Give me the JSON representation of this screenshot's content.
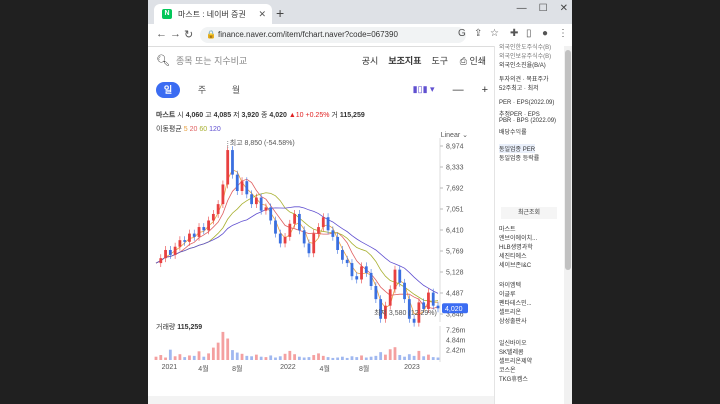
{
  "browser": {
    "tab_title": "마스트 : 네이버 증권",
    "tab_fav": "N",
    "url": "finance.naver.com/item/fchart.naver?code=067390"
  },
  "toolbar": {
    "search_placeholder": "종목 또는 지수비교",
    "links": [
      "공시",
      "보조지표",
      "도구"
    ],
    "print": "인쇄"
  },
  "periods": [
    "일",
    "주",
    "월"
  ],
  "quote": {
    "name": "마스트",
    "open_label": "시",
    "open": "4,060",
    "high_label": "고",
    "high": "4,085",
    "low_label": "저",
    "low": "3,920",
    "close_label": "종",
    "close": "4,020",
    "change": "▲10 +0.25%",
    "vol_label": "거",
    "vol": "115,259"
  },
  "ma": {
    "label": "이동평균",
    "p5": "5",
    "p20": "20",
    "p60": "60",
    "p120": "120"
  },
  "scale_mode": "Linear",
  "chart_data": {
    "type": "line",
    "y_ticks": [
      "8,974",
      "8,333",
      "7,692",
      "7,051",
      "6,410",
      "5,769",
      "5,128",
      "4,487",
      "3,846"
    ],
    "current": "4,020",
    "high_annotation": "최고 8,850 (-54.58%)",
    "low_annotation": "최저 3,580 (12.29%)",
    "price": [
      5400,
      5550,
      5800,
      5650,
      5900,
      6100,
      6050,
      6300,
      6200,
      6500,
      6400,
      6700,
      6900,
      7200,
      7800,
      8850,
      8100,
      7600,
      7900,
      7500,
      7200,
      7400,
      7000,
      7100,
      6700,
      6300,
      6000,
      6200,
      6600,
      6900,
      6400,
      6000,
      5700,
      6300,
      6500,
      6800,
      6400,
      6200,
      5800,
      5500,
      5400,
      5000,
      4900,
      5300,
      5100,
      4700,
      4300,
      3700,
      4100,
      4600,
      5200,
      4800,
      4300,
      3700,
      3580,
      4200,
      4000,
      4500,
      4100,
      4020
    ],
    "ma_colors": [
      "#e8a040",
      "#e06060",
      "#a8b030",
      "#6050d0"
    ],
    "volume_label": "거래량",
    "volume_value": "115,259",
    "volume_ticks": [
      "7.26m",
      "4.84m",
      "2.42m"
    ],
    "volume": [
      0.8,
      1.2,
      0.6,
      2.5,
      0.9,
      1.4,
      0.7,
      1.1,
      1.0,
      2.1,
      0.8,
      1.6,
      3.0,
      4.2,
      6.8,
      5.2,
      2.4,
      1.8,
      1.5,
      1.0,
      0.9,
      1.3,
      0.8,
      0.7,
      1.1,
      0.6,
      0.9,
      1.5,
      2.2,
      1.4,
      0.8,
      0.6,
      0.7,
      1.2,
      1.6,
      1.0,
      0.7,
      0.5,
      0.6,
      0.8,
      0.5,
      0.9,
      0.7,
      1.1,
      0.6,
      0.8,
      1.0,
      1.9,
      1.3,
      2.6,
      3.1,
      1.2,
      0.8,
      1.4,
      1.0,
      2.2,
      0.9,
      1.3,
      0.7,
      0.6
    ],
    "x_labels": [
      "2021",
      "4월",
      "8월",
      "2022",
      "4월",
      "8월",
      "2023"
    ]
  },
  "sidebar": {
    "top_items": [
      "외국인한도주식수(B)",
      "외국인보유주식수(B)",
      "외국인소진율(B/A)"
    ],
    "mid_items": [
      "투자의견 · 목표주가",
      "52주최고 · 최저"
    ],
    "per_items": [
      "PER · EPS(2022.09)",
      "추정PER · EPS",
      "PBR · BPS (2022.09)",
      "배당수익률"
    ],
    "sector_items": [
      "동일업종 PER",
      "동일업종 등락률"
    ],
    "recent_title": "최근조회",
    "recent_group1": [
      "마스트",
      "엔브이에이치...",
      "HLB생명과학",
      "세진티에스",
      "세이브존I&C"
    ],
    "recent_group2": [
      "와이엠텍",
      "이글루",
      "펜타테스민...",
      "셀트리온",
      "삼성출판사"
    ],
    "recent_group3": [
      "일신바이오",
      "SK텔레콤",
      "셀트리온제약",
      "코스온",
      "TKG휴켐스"
    ]
  }
}
